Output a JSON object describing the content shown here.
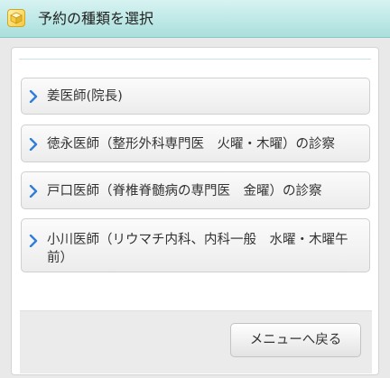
{
  "header": {
    "title": "予約の種類を選択",
    "icon": "cube-icon"
  },
  "menu": {
    "items": [
      {
        "label": "姜医師(院長)",
        "icon": "chevron-right-icon"
      },
      {
        "label": "徳永医師（整形外科専門医　火曜・木曜）の診察",
        "icon": "chevron-right-icon"
      },
      {
        "label": "戸口医師（脊椎脊髄病の専門医　金曜）の診察",
        "icon": "chevron-right-icon"
      },
      {
        "label": "小川医師（リウマチ内科、内科一般　水曜・木曜午前）",
        "icon": "chevron-right-icon"
      }
    ]
  },
  "footer": {
    "back_label": "メニューへ戻る"
  },
  "colors": {
    "header_bg": "#b7e4e1",
    "chevron": "#2f7fd6",
    "page_bg": "#e9e9e9"
  }
}
